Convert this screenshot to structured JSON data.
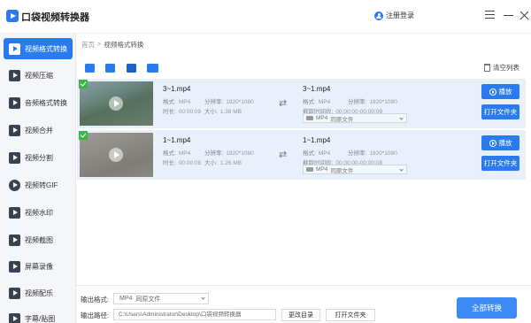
{
  "app": {
    "title": "口袋视频转换器",
    "login": "注册登录"
  },
  "sidebar": {
    "items": [
      {
        "label": "视频格式转换",
        "icon": "video-convert-icon"
      },
      {
        "label": "视频压缩",
        "icon": "video-compress-icon"
      },
      {
        "label": "音频格式转换",
        "icon": "audio-convert-icon"
      },
      {
        "label": "视频合并",
        "icon": "video-merge-icon"
      },
      {
        "label": "视频分割",
        "icon": "video-split-icon"
      },
      {
        "label": "视频转GIF",
        "icon": "gif-icon"
      },
      {
        "label": "视频水印",
        "icon": "watermark-icon"
      },
      {
        "label": "视频截图",
        "icon": "screenshot-icon"
      },
      {
        "label": "屏幕录像",
        "icon": "screen-record-icon"
      },
      {
        "label": "视频配乐",
        "icon": "music-icon"
      },
      {
        "label": "字幕/贴图",
        "icon": "subtitle-icon"
      }
    ]
  },
  "breadcrumb": {
    "home": "首页",
    "sep": ">",
    "current": "视频格式转换"
  },
  "toolbar": {
    "clear_label": "清空列表"
  },
  "files": [
    {
      "name": "3~1.mp4",
      "format_label": "格式:",
      "format": "MP4",
      "res_label": "分辨率:",
      "res": "1920*1080",
      "dur_label": "时长:",
      "dur": "00:00:09",
      "size_label": "大小:",
      "size": "1.38 MB",
      "out_name": "3~1.mp4",
      "out_format": "MP4",
      "out_res": "1920*1080",
      "clip_label": "截取时间段:",
      "clip": "00:00:00-00:00:09",
      "select_format": "MP4",
      "select_quality": "同原文件",
      "play_label": "播放",
      "open_label": "打开文件夹"
    },
    {
      "name": "1~1.mp4",
      "format_label": "格式:",
      "format": "MP4",
      "res_label": "分辨率:",
      "res": "1920*1080",
      "dur_label": "时长:",
      "dur": "00:00:08",
      "size_label": "大小:",
      "size": "1.26 MB",
      "out_name": "1~1.mp4",
      "out_format": "MP4",
      "out_res": "1920*1080",
      "clip_label": "截取时间段:",
      "clip": "00:00:00-00:00:08",
      "select_format": "MP4",
      "select_quality": "同原文件",
      "play_label": "播放",
      "open_label": "打开文件夹"
    }
  ],
  "bottom": {
    "format_label": "输出格式:",
    "format_value": "MP4",
    "format_quality": "同原文件",
    "path_label": "输出路径:",
    "path_value": "C:\\Users\\Administrator\\Desktop\\口袋视频转换器",
    "change_dir": "更改目录",
    "open_folder": "打开文件夹",
    "convert_all": "全部转换"
  },
  "colors": {
    "accent": "#2b7bf0",
    "row_bg": "#e9effb",
    "check": "#3bb54a"
  }
}
